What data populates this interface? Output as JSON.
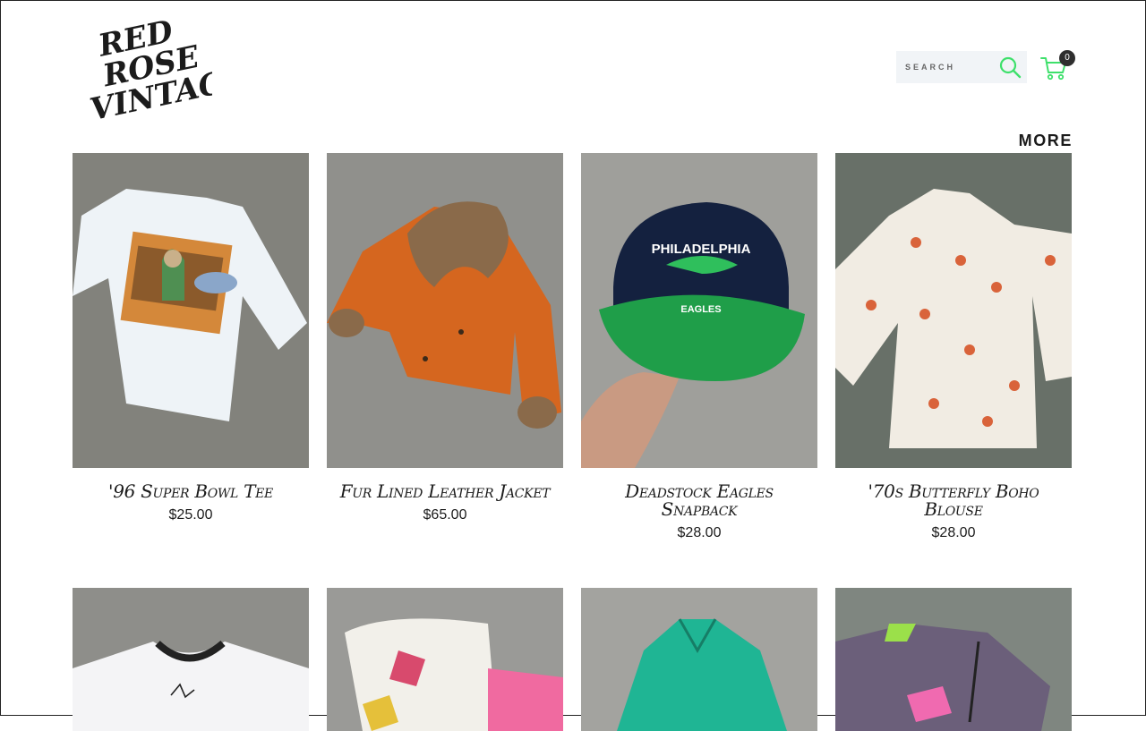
{
  "brand": {
    "logo_lines": [
      "RED",
      "ROSE",
      "VINTAGE"
    ]
  },
  "header": {
    "search_placeholder": "SEARCH",
    "cart_count": "0",
    "accent_color": "#3ee06b"
  },
  "section": {
    "more_label": "MORE"
  },
  "products": [
    {
      "name": "'96 Super Bowl Tee",
      "price": "$25.00"
    },
    {
      "name": "Fur Lined Leather Jacket",
      "price": "$65.00"
    },
    {
      "name": "Deadstock Eagles Snapback",
      "price": "$28.00"
    },
    {
      "name": "'70s Butterfly Boho Blouse",
      "price": "$28.00"
    }
  ],
  "image_text": {
    "cap_text": "PHILADELPHIA",
    "cap_subtext": "EAGLES"
  }
}
